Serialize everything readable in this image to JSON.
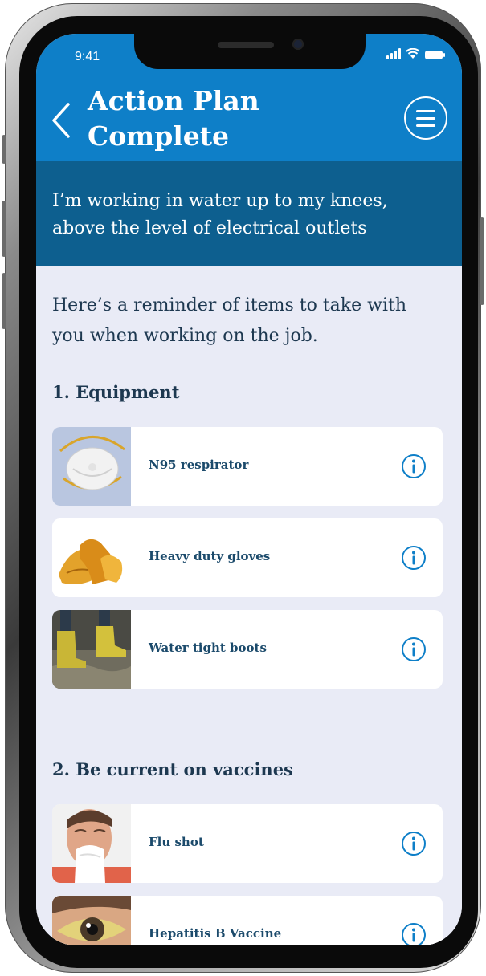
{
  "status_bar": {
    "time": "9:41"
  },
  "header": {
    "title_line1": "Action Plan",
    "title_line2": "Complete"
  },
  "banner": {
    "text": "I’m working in water up to my knees, above the level of electrical outlets"
  },
  "intro": "Here’s a reminder of items to take with you when working on the job.",
  "sections": [
    {
      "title": "1.  Equipment",
      "items": [
        {
          "label": "N95 respirator",
          "icon": "respirator-image"
        },
        {
          "label": "Heavy duty gloves",
          "icon": "gloves-image"
        },
        {
          "label": "Water tight boots",
          "icon": "boots-image"
        }
      ]
    },
    {
      "title": "2.  Be current on vaccines",
      "items": [
        {
          "label": "Flu shot",
          "icon": "sneezing-person-image"
        },
        {
          "label": "Hepatitis B Vaccine",
          "icon": "yellow-eye-image"
        }
      ]
    }
  ],
  "colors": {
    "header_blue": "#0e7fc8",
    "banner_blue": "#0d5f8f",
    "background": "#e9ebf6",
    "text_dark": "#1d3850",
    "info_icon": "#0e7fc8"
  }
}
